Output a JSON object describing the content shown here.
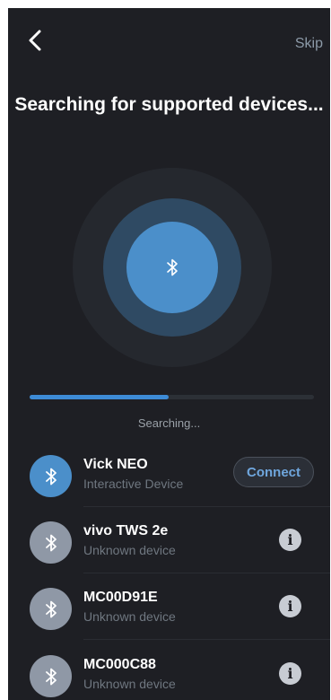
{
  "header": {
    "back_icon": "chevron-left-icon",
    "skip_label": "Skip",
    "title": "Searching for supported devices..."
  },
  "radar": {
    "center_icon": "bluetooth-icon"
  },
  "progress": {
    "fraction": 0.49,
    "status_text": "Searching..."
  },
  "colors": {
    "background": "#1e1f24",
    "accent": "#3d8bd6",
    "active_avatar": "#4b8fca",
    "inactive_avatar": "#8f98a6",
    "connect_text": "#6fa6dd"
  },
  "devices": [
    {
      "name": "Vick NEO",
      "subtitle": "Interactive Device",
      "action": "Connect",
      "icon": "bluetooth-icon"
    },
    {
      "name": "vivo TWS 2e",
      "subtitle": "Unknown device",
      "action_icon": "info-icon",
      "icon": "bluetooth-icon"
    },
    {
      "name": "MC00D91E",
      "subtitle": "Unknown device",
      "action_icon": "info-icon",
      "icon": "bluetooth-icon"
    },
    {
      "name": "MC000C88",
      "subtitle": "Unknown device",
      "action_icon": "info-icon",
      "icon": "bluetooth-icon"
    }
  ]
}
